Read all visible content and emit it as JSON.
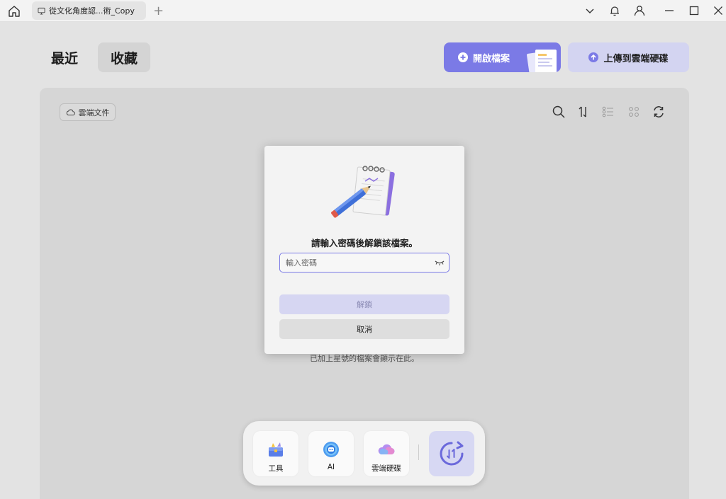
{
  "titlebar": {
    "tab_title": "從文化角度認...術_Copy",
    "new_tab": "+"
  },
  "header": {
    "recent_label": "最近",
    "favorites_label": "收藏",
    "open_file_label": "開啟檔案",
    "upload_label": "上傳到雲端硬碟"
  },
  "panel": {
    "cloud_docs_label": "雲端文件",
    "empty_hint": "已加上星號的檔案會顯示在此。"
  },
  "dialog": {
    "title": "請輸入密碼後解鎖該檔案。",
    "password_placeholder": "輸入密碼",
    "password_value": "",
    "unlock_label": "解鎖",
    "cancel_label": "取消"
  },
  "dock": {
    "tools_label": "工具",
    "ai_label": "AI",
    "cloud_label": "雲端硬碟"
  },
  "colors": {
    "accent": "#7b7ae6",
    "accent_light": "#d3d4f1",
    "background": "#e3e3e3",
    "panel": "#d6d6d6"
  }
}
